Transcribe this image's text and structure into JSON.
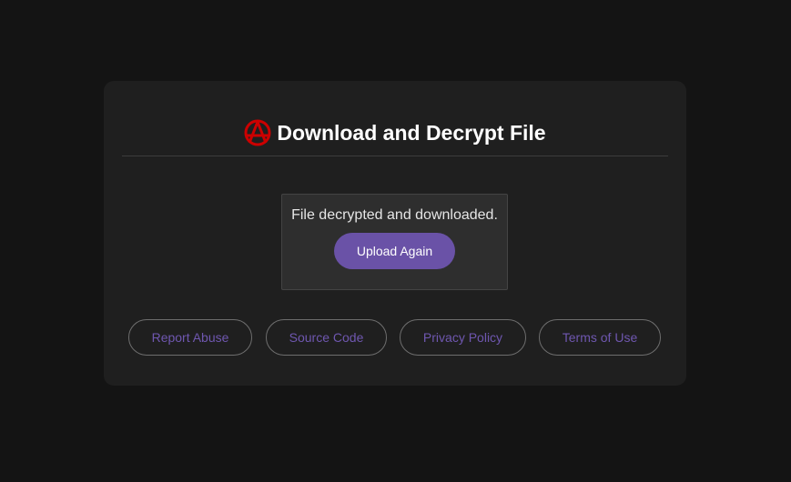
{
  "header": {
    "logo_icon": "anarchy-a-icon",
    "title": "Download and Decrypt File"
  },
  "status": {
    "message": "File decrypted and downloaded.",
    "upload_again_label": "Upload Again"
  },
  "footer": {
    "links": [
      {
        "label": "Report Abuse"
      },
      {
        "label": "Source Code"
      },
      {
        "label": "Privacy Policy"
      },
      {
        "label": "Terms of Use"
      }
    ]
  },
  "colors": {
    "background": "#141414",
    "card": "#1f1f1f",
    "accent": "#6a52a7",
    "link": "#6f57b0",
    "logo": "#cc0000"
  }
}
